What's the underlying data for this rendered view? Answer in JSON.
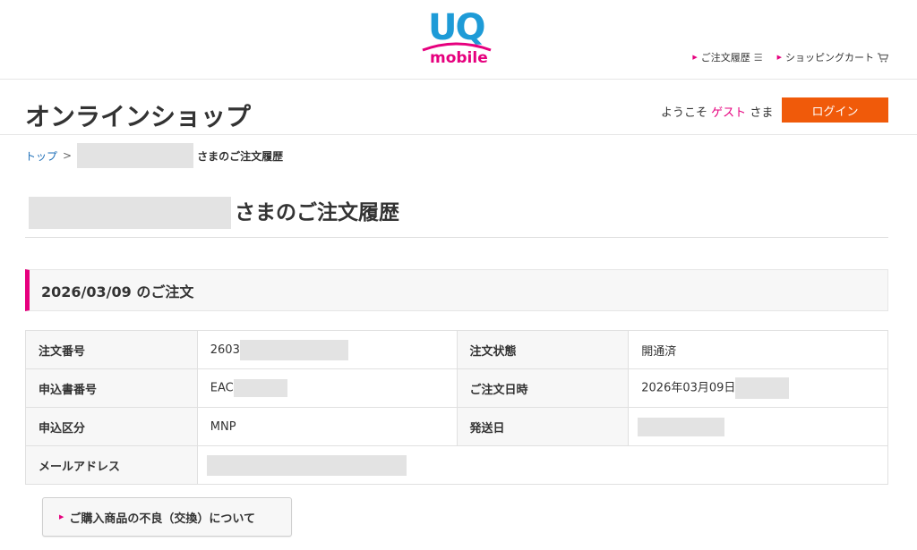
{
  "logo": {
    "brand_top": "UQ",
    "brand_bottom": "mobile"
  },
  "header_links": [
    {
      "label": "ご注文履歴",
      "icon": "menu-icon"
    },
    {
      "label": "ショッピングカート",
      "icon": "cart-icon"
    }
  ],
  "shop": {
    "title": "オンラインショップ",
    "welcome_prefix": "ようこそ",
    "welcome_name": "ゲスト",
    "welcome_suffix": "さま",
    "login_label": "ログイン"
  },
  "breadcrumb": {
    "home": "トップ",
    "separator": ">",
    "current_suffix": "さまのご注文履歴"
  },
  "page_heading": {
    "suffix": "さまのご注文履歴"
  },
  "order": {
    "heading": "2026/03/09 のご注文",
    "rows": [
      {
        "label_left": "注文番号",
        "value_left": "2603",
        "label_right": "注文状態",
        "value_right": "開通済"
      },
      {
        "label_left": "申込書番号",
        "value_left": "EAC",
        "label_right": "ご注文日時",
        "value_right": "2026年03月09日"
      },
      {
        "label_left": "申込区分",
        "value_left": "MNP",
        "label_right": "発送日",
        "value_right": ""
      },
      {
        "label_left": "メールアドレス",
        "value_left": ""
      }
    ]
  },
  "defect_button": {
    "label": "ご購入商品の不良（交換）について"
  },
  "colors": {
    "accent_pink": "#e6007e",
    "login_orange": "#f05a0a",
    "logo_blue": "#1e9bd7"
  }
}
